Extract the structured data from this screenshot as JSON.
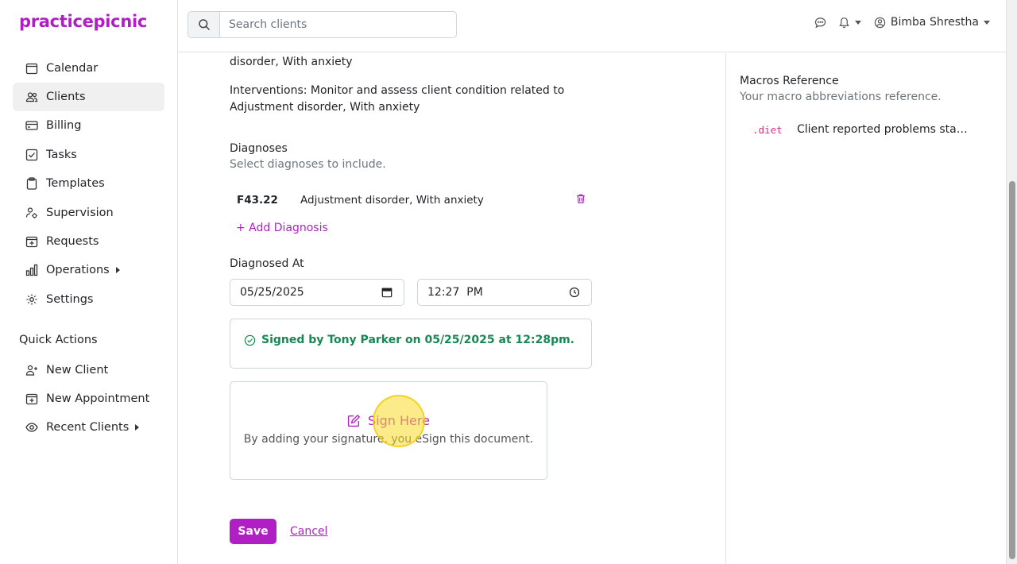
{
  "brand": {
    "name": "practicepicnic"
  },
  "sidebar": {
    "items": [
      {
        "label": "Calendar",
        "icon": "calendar-icon"
      },
      {
        "label": "Clients",
        "icon": "users-icon",
        "active": true
      },
      {
        "label": "Billing",
        "icon": "credit-card-icon"
      },
      {
        "label": "Tasks",
        "icon": "checkbox-icon"
      },
      {
        "label": "Templates",
        "icon": "clipboard-icon"
      },
      {
        "label": "Supervision",
        "icon": "person-gear-icon"
      },
      {
        "label": "Requests",
        "icon": "calendar-plus-icon"
      },
      {
        "label": "Operations",
        "icon": "bar-chart-icon",
        "has_submenu": true
      },
      {
        "label": "Settings",
        "icon": "gear-icon"
      }
    ],
    "quick_actions": {
      "title": "Quick Actions",
      "items": [
        {
          "label": "New Client",
          "icon": "person-plus-icon"
        },
        {
          "label": "New Appointment",
          "icon": "calendar-plus-icon"
        },
        {
          "label": "Recent Clients",
          "icon": "eye-icon",
          "has_submenu": true
        }
      ]
    }
  },
  "topbar": {
    "search": {
      "placeholder": "Search clients",
      "value": ""
    },
    "user": {
      "name": "Bimba Shrestha"
    }
  },
  "main": {
    "goal_tail": "disorder, With anxiety",
    "interventions_line1": "Interventions: Monitor and assess client condition related to",
    "interventions_line2": "Adjustment disorder, With anxiety",
    "diagnoses": {
      "title": "Diagnoses",
      "subtitle": "Select diagnoses to include.",
      "items": [
        {
          "code": "F43.22",
          "name": "Adjustment disorder, With anxiety"
        }
      ],
      "add_label": "+ Add Diagnosis"
    },
    "diagnosed_at": {
      "label": "Diagnosed At",
      "date": "05/25/2025",
      "time": "12:27  PM"
    },
    "signed_message": "Signed by Tony Parker on 05/25/2025 at 12:28pm.",
    "sign": {
      "title": "Sign Here",
      "subtitle": "By adding your signature, you eSign this document."
    },
    "save_label": "Save",
    "cancel_label": "Cancel"
  },
  "right_panel": {
    "title": "Macros Reference",
    "subtitle": "Your macro abbreviations reference.",
    "macros": [
      {
        "code": ".diet",
        "text": "Client reported problems stayi..."
      }
    ]
  },
  "colors": {
    "brand": "#b01fc4",
    "success": "#198754",
    "macro_code": "#d63384"
  }
}
